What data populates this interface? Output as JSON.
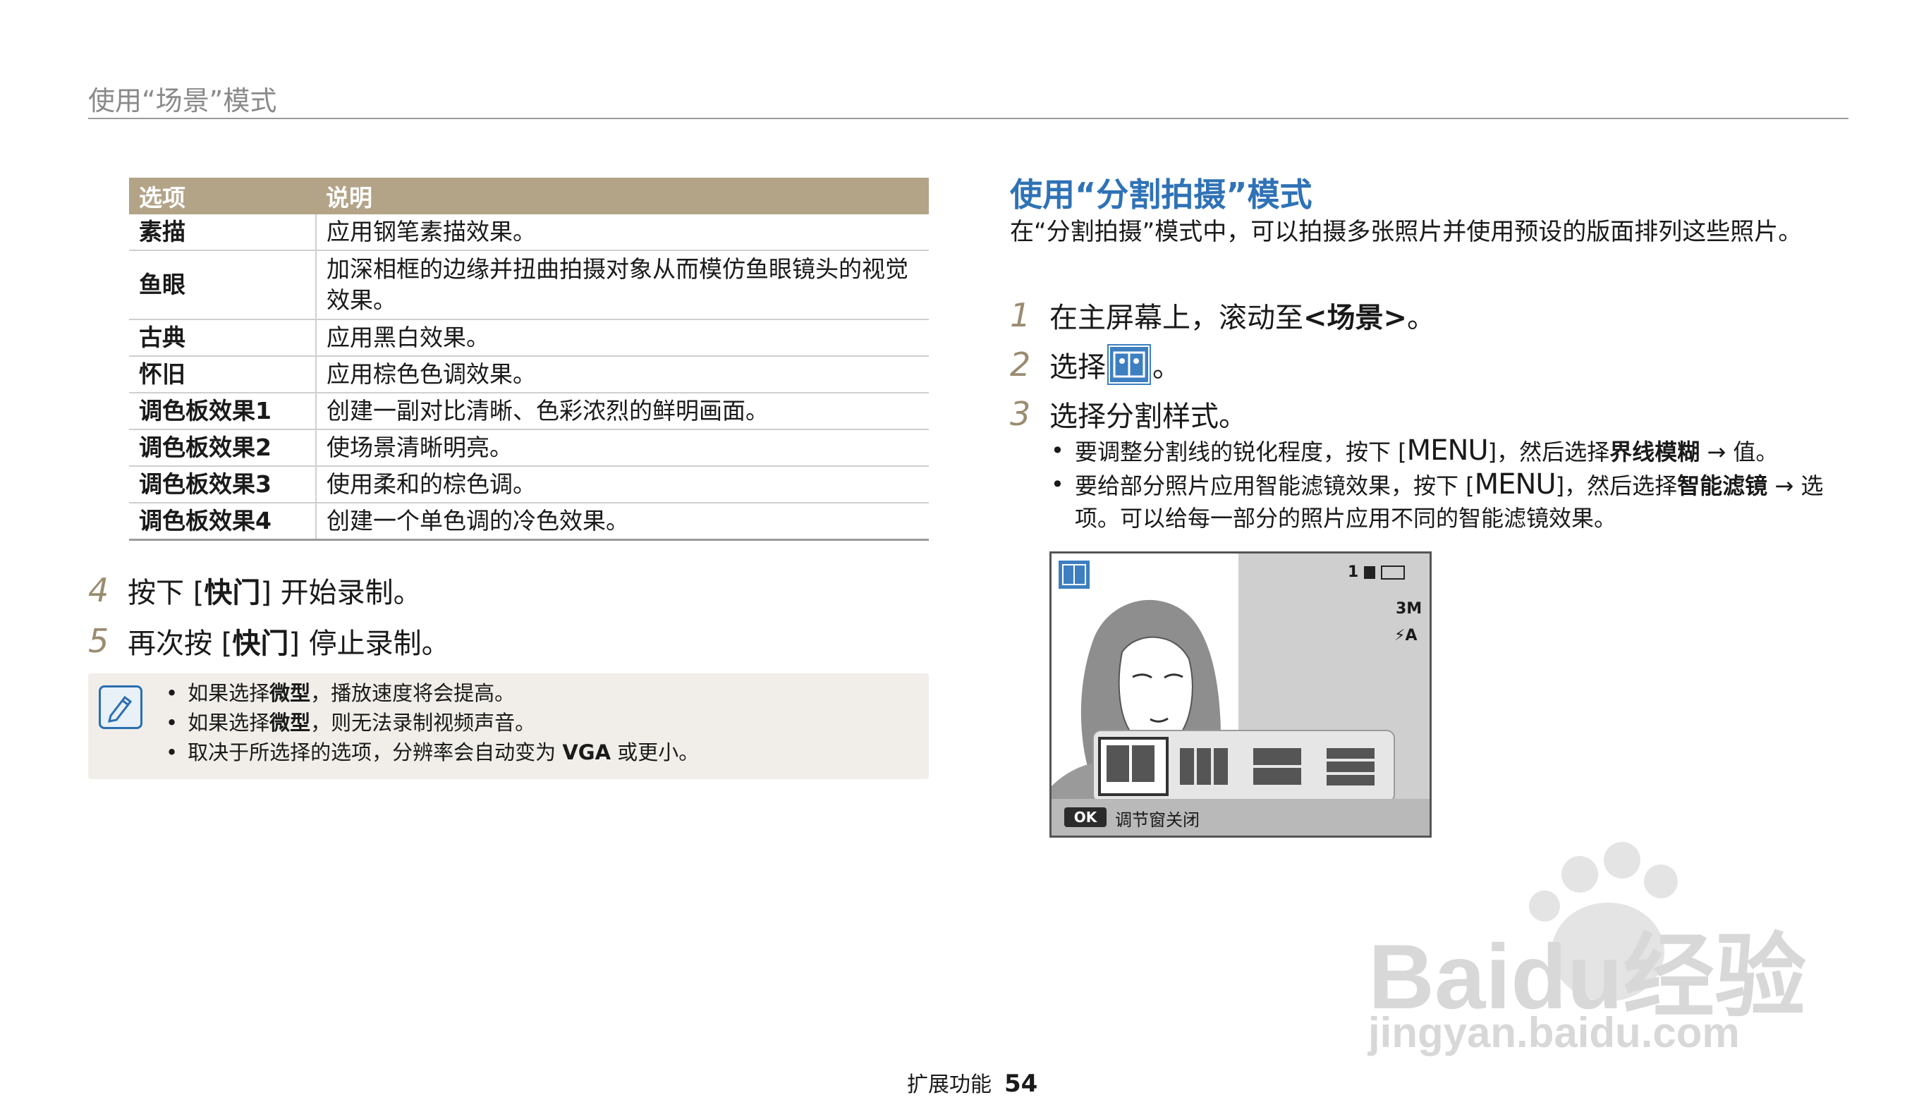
{
  "header": {
    "title": "使用“场景”模式"
  },
  "table": {
    "headers": [
      "选项",
      "说明"
    ],
    "rows": [
      {
        "name": "素描",
        "desc": "应用钢笔素描效果。"
      },
      {
        "name": "鱼眼",
        "desc": "加深相框的边缘并扭曲拍摄对象从而模仿鱼眼镜头的视觉效果。"
      },
      {
        "name": "古典",
        "desc": "应用黑白效果。"
      },
      {
        "name": "怀旧",
        "desc": "应用棕色色调效果。"
      },
      {
        "name": "调色板效果1",
        "desc": "创建一副对比清晰、色彩浓烈的鲜明画面。"
      },
      {
        "name": "调色板效果2",
        "desc": "使场景清晰明亮。"
      },
      {
        "name": "调色板效果3",
        "desc": "使用柔和的棕色调。"
      },
      {
        "name": "调色板效果4",
        "desc": "创建一个单色调的冷色效果。"
      }
    ]
  },
  "left_steps": [
    {
      "num": "4",
      "pre": "按下 [",
      "key": "快门",
      "post": "] 开始录制。"
    },
    {
      "num": "5",
      "pre": "再次按 [",
      "key": "快门",
      "post": "] 停止录制。"
    }
  ],
  "note": {
    "items": [
      {
        "pre": "如果选择",
        "bold": "微型",
        "post": "，播放速度将会提高。"
      },
      {
        "pre": "如果选择",
        "bold": "微型",
        "post": "，则无法录制视频声音。"
      },
      {
        "pre": "取决于所选择的选项，分辨率会自动变为 ",
        "bold": "VGA",
        "post": " 或更小。"
      }
    ]
  },
  "right": {
    "title": "使用“分割拍摄”模式",
    "intro": "在“分割拍摄”模式中，可以拍摄多张照片并使用预设的版面排列这些照片。",
    "step1": {
      "num": "1",
      "pre": "在主屏幕上，滚动至",
      "bold": "<场景>",
      "post": "。"
    },
    "step2": {
      "num": "2",
      "pre": "选择 ",
      "post": "。"
    },
    "step3": {
      "num": "3",
      "text": "选择分割样式。"
    },
    "bullet1": {
      "pre": "要调整分割线的锐化程度，按下 [",
      "key": "MENU",
      "mid": "]，然后选择",
      "bold": "界线模糊",
      "post": " → 值。"
    },
    "bullet2": {
      "pre": "要给部分照片应用智能滤镜效果，按下 [",
      "key": "MENU",
      "mid": "]，然后选择",
      "bold": "智能滤镜",
      "post": " → 选项。可以给每一部分的照片应用不同的智能滤镜效果。"
    }
  },
  "camera": {
    "ok": "OK",
    "ok_label": "调节窗关闭",
    "count": "1",
    "size": "3M",
    "flash": "⚡A"
  },
  "watermark": {
    "brand": "Baidu经验",
    "url": "jingyan.baidu.com"
  },
  "footer": {
    "section": "扩展功能",
    "page": "54"
  }
}
